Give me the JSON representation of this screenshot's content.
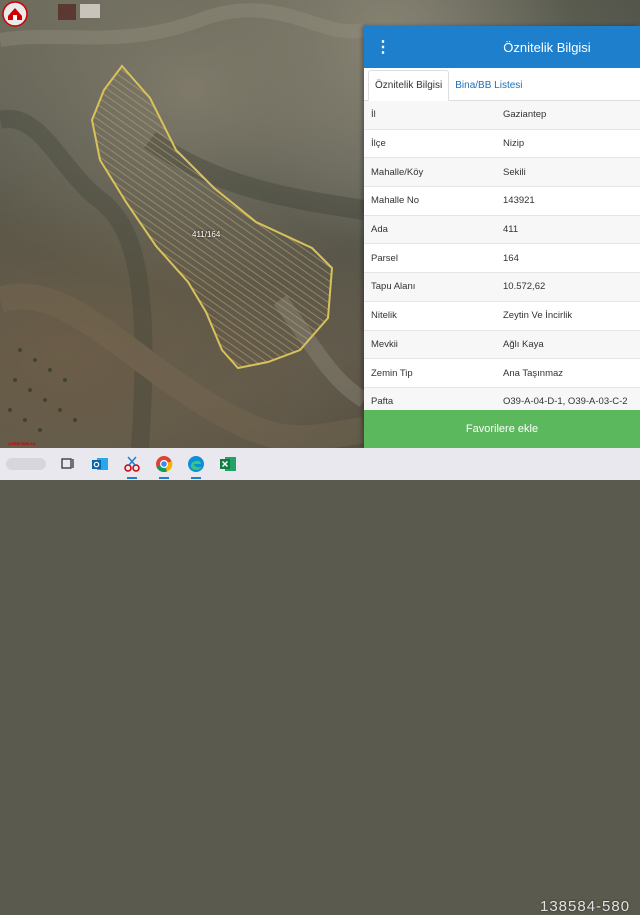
{
  "map": {
    "parcel_label": "411/164",
    "logo_text": "ÇARŞI EMLAK"
  },
  "panel": {
    "title": "Öznitelik Bilgisi",
    "menu_icon": "vertical-dots-icon",
    "tabs": [
      {
        "label": "Öznitelik Bilgisi",
        "active": true
      },
      {
        "label": "Bina/BB Listesi",
        "active": false
      }
    ],
    "rows": [
      {
        "key": "İl",
        "value": "Gaziantep"
      },
      {
        "key": "İlçe",
        "value": "Nizip"
      },
      {
        "key": "Mahalle/Köy",
        "value": "Sekili"
      },
      {
        "key": "Mahalle No",
        "value": "143921"
      },
      {
        "key": "Ada",
        "value": "411"
      },
      {
        "key": "Parsel",
        "value": "164"
      },
      {
        "key": "Tapu Alanı",
        "value": "10.572,62"
      },
      {
        "key": "Nitelik",
        "value": "Zeytin Ve İncirlik"
      },
      {
        "key": "Mevkii",
        "value": "Ağlı Kaya"
      },
      {
        "key": "Zemin Tip",
        "value": "Ana Taşınmaz"
      },
      {
        "key": "Pafta",
        "value": "O39-A-04-D-1, O39-A-03-C-2"
      }
    ],
    "favorite_button": "Favorilere ekle"
  },
  "taskbar": {
    "icons": [
      "search-bar-icon",
      "task-view-icon",
      "outlook-icon",
      "snip-tool-icon",
      "chrome-icon",
      "edge-icon",
      "excel-icon"
    ],
    "watermark": "138584-580"
  },
  "colors": {
    "header": "#1e7fcc",
    "favorite": "#5cb85c",
    "parcel_outline": "#d8c25a"
  }
}
